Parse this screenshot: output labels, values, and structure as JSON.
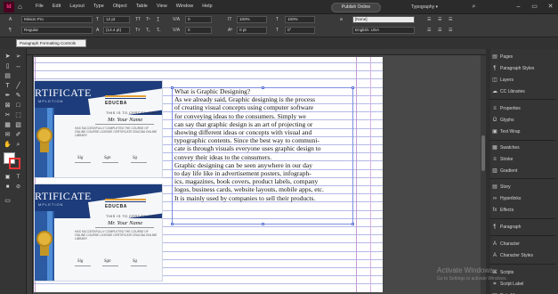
{
  "app": {
    "logo": "Id",
    "menu": [
      "File",
      "Edit",
      "Layout",
      "Type",
      "Object",
      "Table",
      "View",
      "Window",
      "Help"
    ],
    "publish_label": "Publish Online",
    "workspace": "Typography"
  },
  "controlbar": {
    "font_family": "Minion Pro",
    "font_style": "Regular",
    "font_size": "12 pt",
    "leading": "(14.4 pt)",
    "tracking": "0",
    "kerning": "0",
    "vertical_scale": "100%",
    "horizontal_scale": "100%",
    "baseline_shift": "0 pt",
    "skew": "0°",
    "char_style": "[None]",
    "language": "English: USA"
  },
  "tooltip": "Paragraph Formatting Controls",
  "document": {
    "certificate": {
      "title": "RTIFICATE",
      "subtitle": "MPLETION",
      "logo": "EDUCBA",
      "certify": "THIS IS TO CERTIFY THAT",
      "name": "Mr. Your Name",
      "body": "HAS SUCCESSFULLY COMPLETED THE COURSE OF ONLINE COURSE LICENSE CERTIFICATE EDUCBA ONLINE LIBRARY"
    },
    "paragraph_lines": [
      "What is Graphic Designing?",
      "As we already said, Graphic designing is the process",
      "of creating visual concepts using computer software",
      "for conveying ideas to the consumers. Simply we",
      "can say that graphic design is an art of projecting or",
      "showing different ideas or concepts with visual and",
      "typographic contents. Since the best way to communi-",
      "cate is through visuals everyone uses graphic design to",
      "convey their ideas to the consumers.",
      "Graphic designing can be seen anywhere in our day",
      "to day life like in advertisement posters, infograph-",
      "ics, magazines, book covers, product labels, company",
      "logos, business cards, website layouts, mobile apps, etc.",
      "It is mainly used by companies to sell their products."
    ]
  },
  "panel": {
    "items": [
      {
        "label": "Pages",
        "icon": "pages-icon"
      },
      {
        "label": "Paragraph Styles",
        "icon": "paragraph-styles-icon"
      },
      {
        "label": "Layers",
        "icon": "layers-icon"
      },
      {
        "label": "CC Libraries",
        "icon": "cc-libraries-icon"
      },
      {
        "label": "Properties",
        "icon": "properties-icon"
      },
      {
        "label": "Glyphs",
        "icon": "glyphs-icon"
      },
      {
        "label": "Text Wrap",
        "icon": "text-wrap-icon"
      },
      {
        "label": "Swatches",
        "icon": "swatches-icon"
      },
      {
        "label": "Stroke",
        "icon": "stroke-icon"
      },
      {
        "label": "Gradient",
        "icon": "gradient-icon"
      },
      {
        "label": "Story",
        "icon": "story-icon"
      },
      {
        "label": "Hyperlinks",
        "icon": "hyperlinks-icon"
      },
      {
        "label": "Effects",
        "icon": "effects-icon"
      },
      {
        "label": "Paragraph",
        "icon": "paragraph-icon"
      },
      {
        "label": "Character",
        "icon": "character-icon"
      },
      {
        "label": "Character Styles",
        "icon": "character-styles-icon"
      },
      {
        "label": "Scripts",
        "icon": "scripts-icon"
      },
      {
        "label": "Script Label",
        "icon": "script-label-icon"
      },
      {
        "label": "Data Merge",
        "icon": "data-merge-icon"
      }
    ]
  },
  "watermark": {
    "title": "Activate Windows",
    "subtitle": "Go to Settings to activate Windows."
  },
  "colors": {
    "accent": "#ff3a85",
    "frame": "#7d8fe0",
    "cert_blue": "#1d3c7b",
    "cert_gold": "#e3b43a"
  }
}
